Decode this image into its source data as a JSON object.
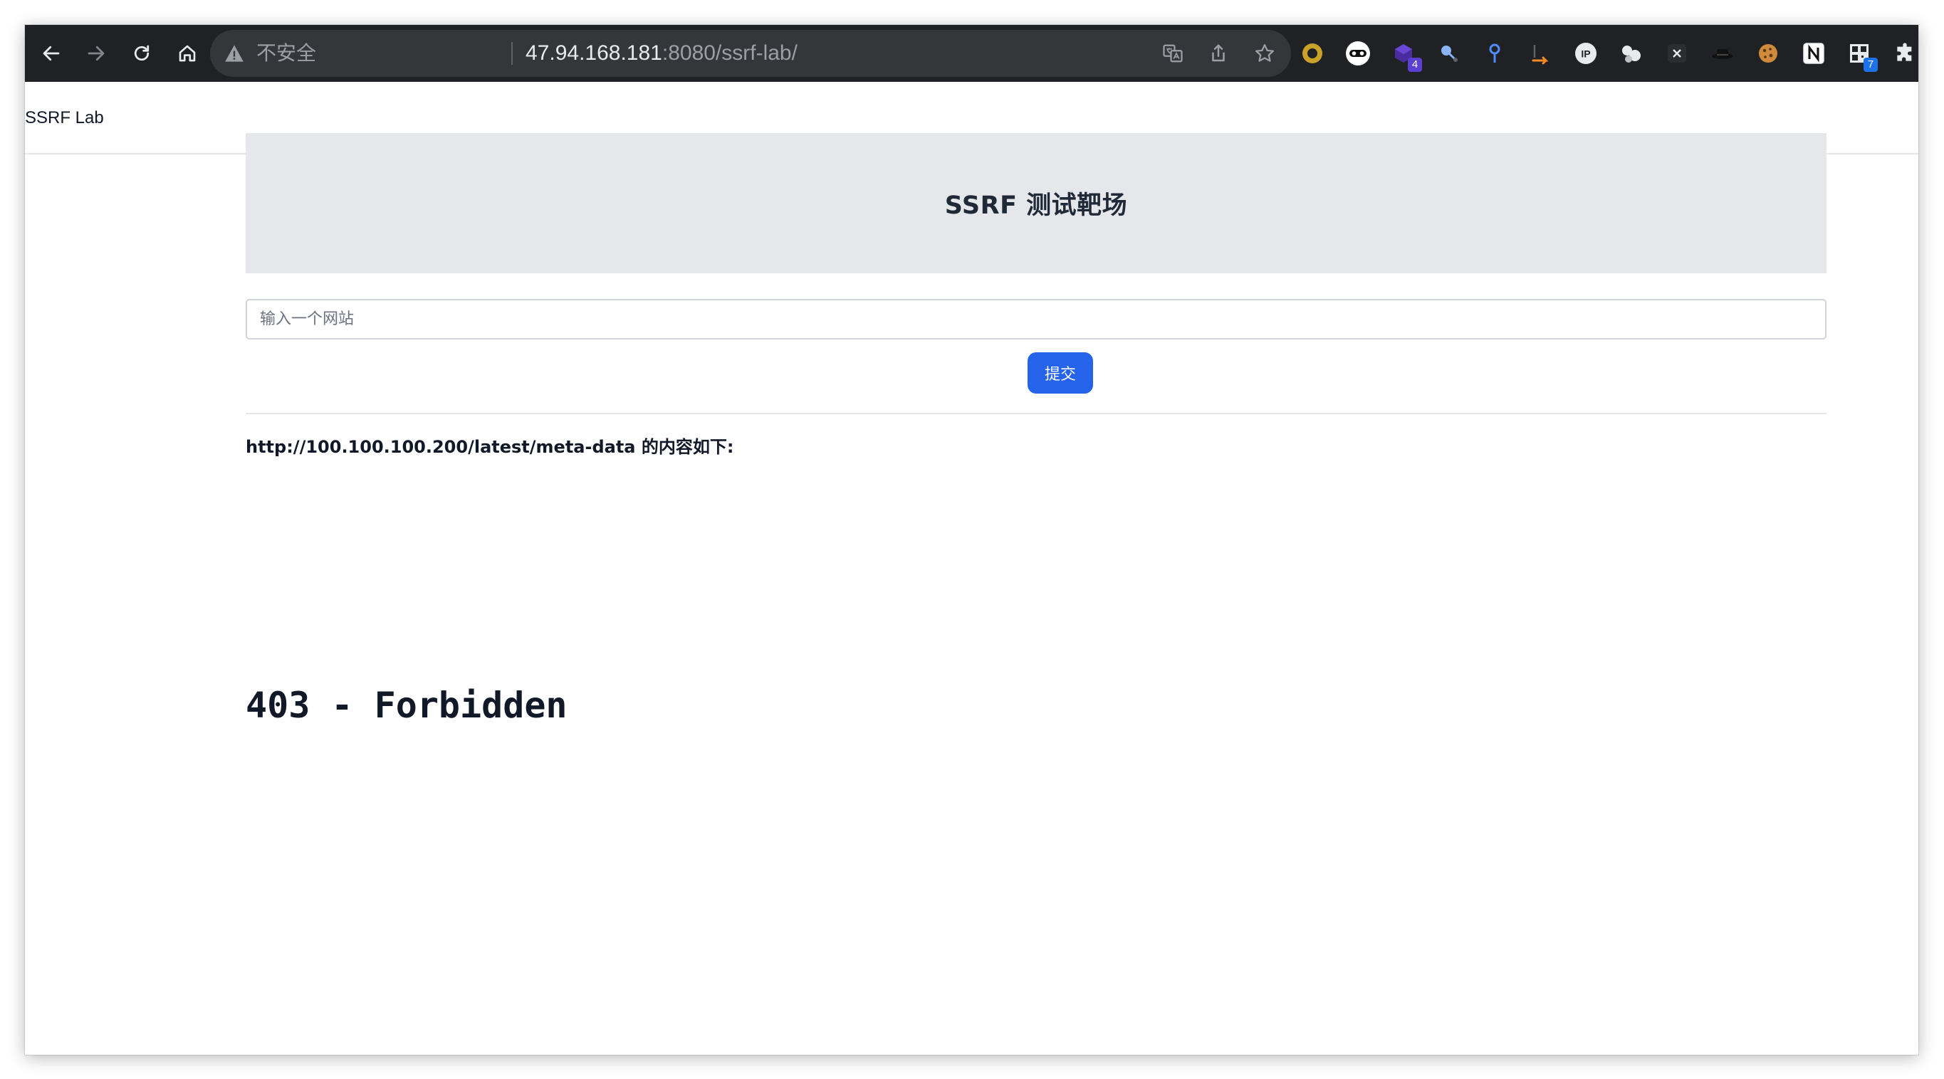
{
  "browser": {
    "security_label": "不安全",
    "url_host": "47.94.168.181",
    "url_rest": ":8080/ssrf-lab/",
    "nav_icons": [
      "back-arrow-icon",
      "forward-arrow-icon",
      "reload-icon",
      "home-icon"
    ],
    "omnibox_actions": [
      "translate-icon",
      "share-icon",
      "bookmark-star-icon"
    ],
    "extensions": [
      {
        "name": "circle-extension-icon",
        "badge": ""
      },
      {
        "name": "mask-extension-icon",
        "badge": ""
      },
      {
        "name": "cube-extension-icon",
        "badge": "4"
      },
      {
        "name": "satellite-extension-icon",
        "badge": ""
      },
      {
        "name": "pin-extension-icon",
        "badge": ""
      },
      {
        "name": "flag-extension-icon",
        "badge": ""
      },
      {
        "name": "ip-extension-icon",
        "badge": ""
      },
      {
        "name": "cluster-extension-icon",
        "badge": ""
      },
      {
        "name": "x-extension-icon",
        "badge": ""
      },
      {
        "name": "hat-extension-icon",
        "badge": ""
      },
      {
        "name": "cookie-extension-icon",
        "badge": ""
      },
      {
        "name": "notion-extension-icon",
        "badge": ""
      },
      {
        "name": "qr-extension-icon",
        "badge": "7"
      },
      {
        "name": "puzzle-extensions-icon",
        "badge": ""
      }
    ]
  },
  "navbar": {
    "brand": "SSRF Lab"
  },
  "hero": {
    "title": "SSRF 测试靶场"
  },
  "form": {
    "input_value": "",
    "input_placeholder": "输入一个网站",
    "submit_label": "提交"
  },
  "result": {
    "label": "http://100.100.100.200/latest/meta-data 的内容如下:",
    "content": "403 - Forbidden"
  },
  "colors": {
    "toolbar_bg": "#202124",
    "omnibox_bg": "#35363a",
    "hero_bg": "#e5e7eb",
    "button_bg": "#2563eb",
    "text_dark": "#111827"
  }
}
